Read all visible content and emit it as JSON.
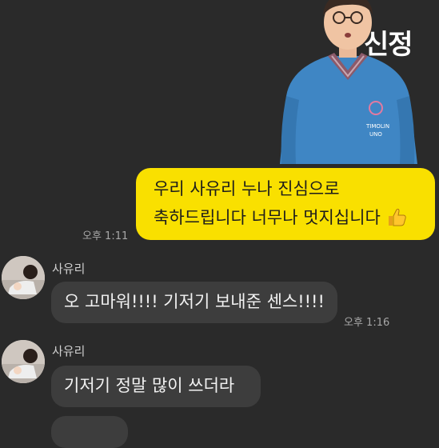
{
  "sticker": {
    "text": "신정"
  },
  "messages": {
    "me": {
      "line1": "우리 사유리 누나 진심으로",
      "line2": "축하드립니다 너무나 멋지십니다",
      "emoji": "thumbs-up-icon",
      "time": "오후 1:11"
    },
    "group": {
      "sender1": "사유리",
      "msg1": "오 고마워!!!! 기저기 보내준 센스!!!!",
      "time1": "오후 1:16",
      "sender2": "사유리",
      "msg2": "기저기 정말 많이 쓰더라"
    }
  },
  "colors": {
    "background": "#2a2a2a",
    "my_bubble": "#f9e000",
    "other_bubble": "#3d3d3d"
  }
}
